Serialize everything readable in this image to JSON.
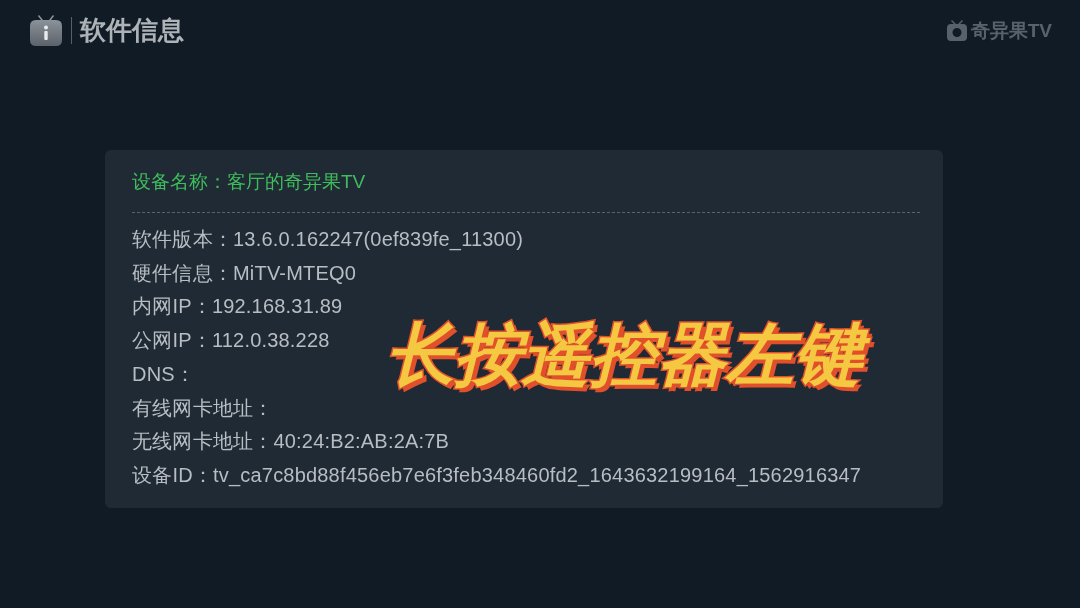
{
  "header": {
    "title": "软件信息",
    "brand": "奇异果TV"
  },
  "panel": {
    "device_name": "设备名称：客厅的奇异果TV",
    "rows": [
      "软件版本：13.6.0.162247(0ef839fe_11300)",
      "硬件信息：MiTV-MTEQ0",
      "内网IP：192.168.31.89",
      "公网IP：112.0.38.228",
      "DNS：",
      "有线网卡地址：",
      "无线网卡地址：40:24:B2:AB:2A:7B",
      "设备ID：tv_ca7c8bd88f456eb7e6f3feb348460fd2_1643632199164_1562916347"
    ]
  },
  "overlay_caption": "长按遥控器左键"
}
